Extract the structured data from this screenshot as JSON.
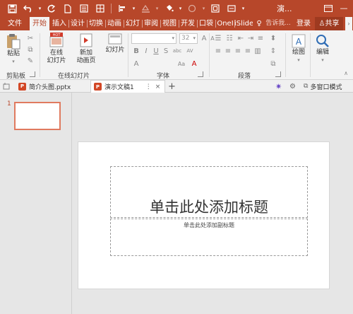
{
  "titlebar": {
    "title": "演...",
    "quick_access": [
      "save-icon",
      "undo-icon",
      "redo-icon",
      "new-file-icon",
      "print-icon",
      "table-icon",
      "align-icon",
      "shape-fill-icon",
      "paint-bucket-icon",
      "shape-icon",
      "text-box-icon"
    ],
    "window_buttons": [
      "ribbon-options-icon"
    ]
  },
  "tabs": {
    "file": "文件",
    "home": "开始",
    "insert": "插入",
    "design": "设计",
    "transitions": "切换",
    "animations": "动画",
    "slideshow": "幻灯",
    "review": "审阅",
    "view": "视图",
    "developer": "开发",
    "pocket": "口袋",
    "onenote": "OneI",
    "islide": "iSlide",
    "tell_me": "告诉我...",
    "login": "登录",
    "share": "共享"
  },
  "ribbon": {
    "clipboard": {
      "paste": "粘贴",
      "label": "剪贴板"
    },
    "slides": {
      "online": "在线",
      "online2": "幻灯片",
      "new": "新加",
      "new2": "动画页",
      "layout": "幻灯片",
      "label": "在线幻灯片",
      "hot_badge": "HOT"
    },
    "font": {
      "label": "字体",
      "size": "32",
      "bold": "B",
      "italic": "I",
      "underline": "U",
      "strike": "S",
      "shadow": "abc",
      "spacing": "AV",
      "case": "Aa",
      "color": "A",
      "grow": "A",
      "shrink": "A",
      "clear": "A"
    },
    "paragraph": {
      "label": "段落"
    },
    "drawing": {
      "label": "绘图"
    },
    "editing": {
      "label": "编辑"
    }
  },
  "doctabs": {
    "tab1": "简介头图.pptx",
    "tab2": "演示文稿1",
    "new_tab": "+",
    "more": "⋮",
    "close": "×",
    "multi_window": "多窗口模式"
  },
  "thumbnails": {
    "slide_number": "1"
  },
  "slide": {
    "title_placeholder": "单击此处添加标题",
    "subtitle_placeholder": "单击此处添加副标题"
  },
  "colors": {
    "accent": "#b7472a",
    "ribbon_bg": "#f3f3f3",
    "workspace": "#e6e6e6"
  }
}
